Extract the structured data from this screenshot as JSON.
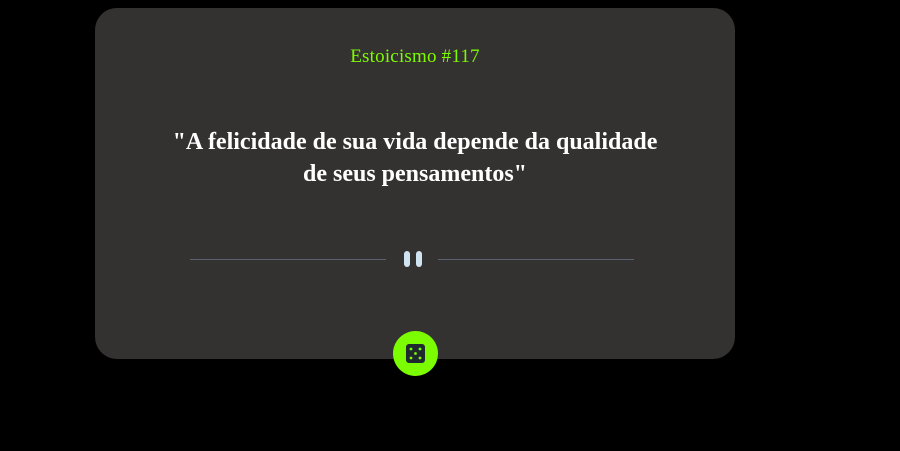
{
  "card": {
    "advice_label": "Estoicismo #117",
    "quote": "\"A felicidade de sua vida depende da qualidade de seus pensamentos\""
  },
  "divider": {
    "icon": "pause-icon"
  },
  "dice_button": {
    "icon": "dice-icon"
  },
  "colors": {
    "background": "#000000",
    "card": "#343131",
    "accent": "#7cfc00",
    "text": "#ffffff",
    "divider_line": "#5a6270",
    "pause_bars": "#cfe3f0"
  }
}
